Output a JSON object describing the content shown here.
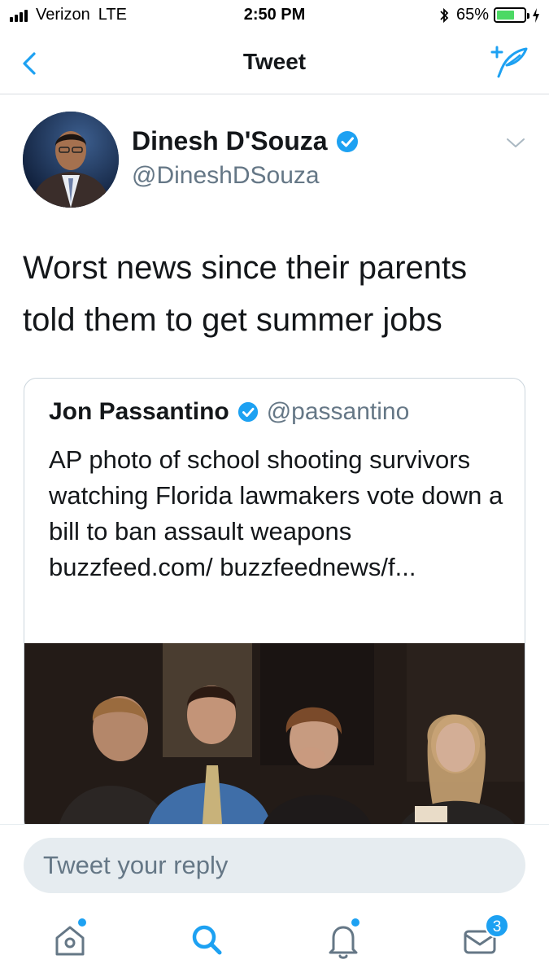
{
  "status_bar": {
    "carrier": "Verizon",
    "network": "LTE",
    "time": "2:50 PM",
    "battery_percent": "65%",
    "battery_level": 0.65
  },
  "nav": {
    "title": "Tweet",
    "back_icon": "chevron-left-icon",
    "compose_icon": "compose-tweet-icon"
  },
  "tweet": {
    "author_name": "Dinesh D'Souza",
    "author_handle": "@DineshDSouza",
    "verified": true,
    "text": "Worst news since their parents told them to get summer jobs"
  },
  "quoted_tweet": {
    "author_name": "Jon Passantino",
    "author_handle": "@passantino",
    "verified": true,
    "text": "AP photo of school shooting survivors watching Florida lawmakers vote down a bill to ban assault weapons buzzfeed.com/ buzzfeednews/f..."
  },
  "reply": {
    "placeholder": "Tweet your reply"
  },
  "tab_bar": {
    "items": [
      {
        "name": "home-icon",
        "active": false,
        "dot": true
      },
      {
        "name": "search-icon",
        "active": true,
        "dot": false
      },
      {
        "name": "notifications-icon",
        "active": false,
        "dot": true
      },
      {
        "name": "messages-icon",
        "active": false,
        "badge": "3"
      }
    ]
  },
  "colors": {
    "accent": "#1da1f2",
    "text": "#14171a",
    "secondary_text": "#657786",
    "border": "#ccd6dd"
  }
}
